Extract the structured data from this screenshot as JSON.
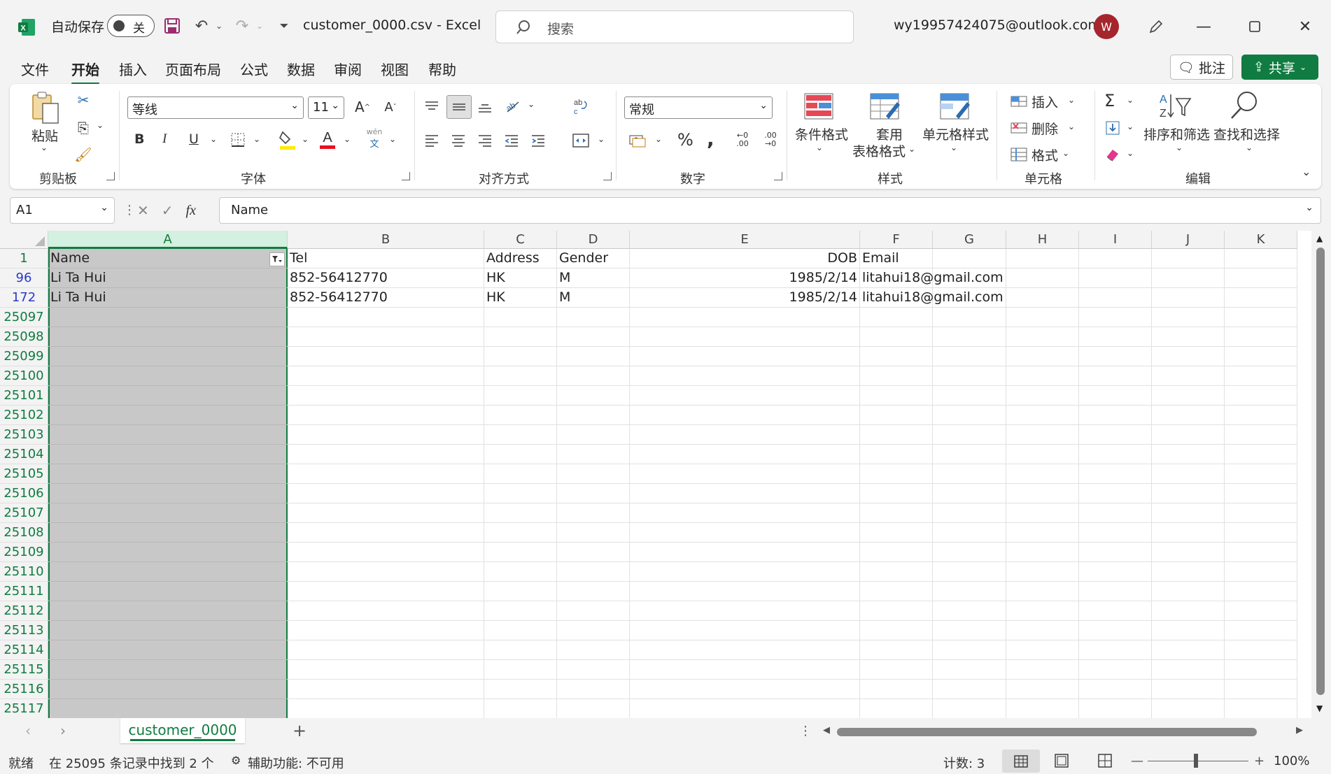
{
  "window": {
    "autosave_label": "自动保存",
    "autosave_state": "关",
    "doc_title": "customer_0000.csv  -  Excel",
    "search_placeholder": "搜索",
    "account": "wy19957424075@outlook.com",
    "avatar_letter": "W"
  },
  "menu": {
    "tabs": [
      "文件",
      "开始",
      "插入",
      "页面布局",
      "公式",
      "数据",
      "审阅",
      "视图",
      "帮助"
    ],
    "active": "开始",
    "comment_label": "批注",
    "share_label": "共享"
  },
  "ribbon": {
    "clipboard": {
      "label": "剪贴板",
      "paste": "粘贴"
    },
    "font": {
      "label": "字体",
      "name": "等线",
      "size": "11",
      "bold": "B",
      "italic": "I",
      "underline": "U",
      "phonetic_top": "wén",
      "phonetic_bottom": "文"
    },
    "alignment": {
      "label": "对齐方式"
    },
    "number": {
      "label": "数字",
      "format": "常规"
    },
    "styles": {
      "label": "样式",
      "conditional": "条件格式",
      "table_line1": "套用",
      "table_line2": "表格格式",
      "cell_styles": "单元格样式"
    },
    "cells": {
      "label": "单元格",
      "insert": "插入",
      "delete": "删除",
      "format": "格式"
    },
    "editing": {
      "label": "编辑",
      "sort": "排序和筛选",
      "find": "查找和选择"
    }
  },
  "formula_bar": {
    "name_box": "A1",
    "fx": "fx",
    "content": "Name"
  },
  "columns": [
    "A",
    "B",
    "C",
    "D",
    "E",
    "F",
    "G",
    "H",
    "I",
    "J",
    "K"
  ],
  "rows": [
    {
      "num": "1",
      "blue": false,
      "cells": [
        "Name",
        "Tel",
        "Address",
        "Gender",
        "DOB",
        "Email"
      ]
    },
    {
      "num": "96",
      "blue": true,
      "cells": [
        "Li Ta Hui",
        "852-56412770",
        "HK",
        "M",
        "1985/2/14",
        "litahui18@gmail.com"
      ]
    },
    {
      "num": "172",
      "blue": true,
      "cells": [
        "Li Ta Hui",
        "852-56412770",
        "HK",
        "M",
        "1985/2/14",
        "litahui18@gmail.com"
      ]
    },
    {
      "num": "25097",
      "blue": false,
      "cells": []
    },
    {
      "num": "25098",
      "blue": false,
      "cells": []
    },
    {
      "num": "25099",
      "blue": false,
      "cells": []
    },
    {
      "num": "25100",
      "blue": false,
      "cells": []
    },
    {
      "num": "25101",
      "blue": false,
      "cells": []
    },
    {
      "num": "25102",
      "blue": false,
      "cells": []
    },
    {
      "num": "25103",
      "blue": false,
      "cells": []
    },
    {
      "num": "25104",
      "blue": false,
      "cells": []
    },
    {
      "num": "25105",
      "blue": false,
      "cells": []
    },
    {
      "num": "25106",
      "blue": false,
      "cells": []
    },
    {
      "num": "25107",
      "blue": false,
      "cells": []
    },
    {
      "num": "25108",
      "blue": false,
      "cells": []
    },
    {
      "num": "25109",
      "blue": false,
      "cells": []
    },
    {
      "num": "25110",
      "blue": false,
      "cells": []
    },
    {
      "num": "25111",
      "blue": false,
      "cells": []
    },
    {
      "num": "25112",
      "blue": false,
      "cells": []
    },
    {
      "num": "25113",
      "blue": false,
      "cells": []
    },
    {
      "num": "25114",
      "blue": false,
      "cells": []
    },
    {
      "num": "25115",
      "blue": false,
      "cells": []
    },
    {
      "num": "25116",
      "blue": false,
      "cells": []
    },
    {
      "num": "25117",
      "blue": false,
      "cells": []
    }
  ],
  "sheet_tab": "customer_0000",
  "status": {
    "ready": "就绪",
    "filter_info": "在 25095 条记录中找到 2 个",
    "accessibility": "辅助功能: 不可用",
    "count": "计数: 3",
    "zoom": "100%"
  },
  "colors": {
    "accent": "#107c41",
    "avatar": "#a4262c",
    "filtered_row": "#2b39c8"
  }
}
